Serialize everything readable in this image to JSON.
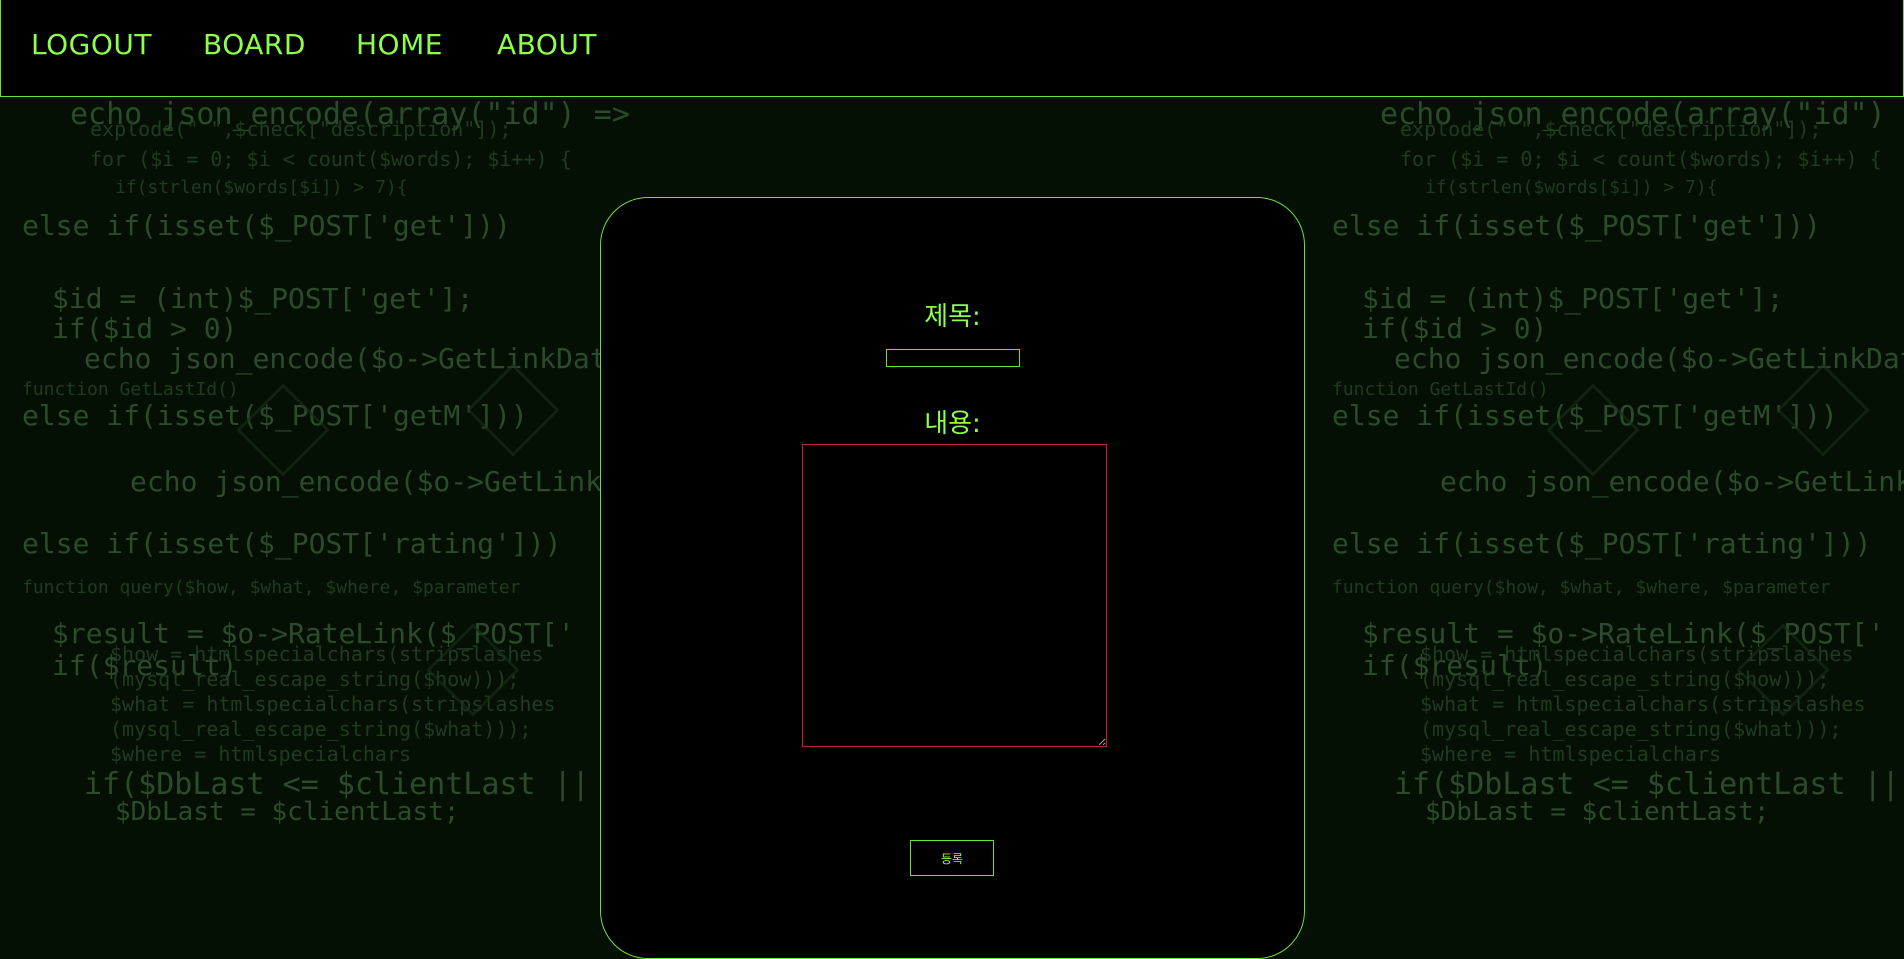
{
  "nav": {
    "items": [
      {
        "label": "LOGOUT"
      },
      {
        "label": "BOARD"
      },
      {
        "label": "HOME"
      },
      {
        "label": "ABOUT"
      }
    ]
  },
  "form": {
    "title_label": "제목:",
    "title_value": "",
    "content_label": "내용:",
    "content_value": "",
    "submit_label": "등록"
  },
  "background_code": [
    "echo json_encode(array(\"id\") => $DbLast, \"r\" => $o->GetReserved",
    "explode(\" \",$check[\"description\"]);",
    "for ($i = 0; $i < count($words); $i++) {",
    "if(strlen($words[$i]) > 7){",
    "else if(isset($_POST['get']))",
    "$id = (int)$_POST['get'];",
    "if($id > 0)",
    "echo json_encode($o->GetLinkData",
    "function GetLastId()",
    "else if(isset($_POST['getM']))",
    "echo json_encode($o->GetLinksData",
    "else if(isset($_POST['rating']))",
    "function query($how, $what, $where, $parameter",
    "$result = $o->RateLink($_POST['",
    "if($result)",
    "$how = htmlspecialchars(stripslashes",
    "(mysql_real_escape_string($how)));",
    "$what = htmlspecialchars(stripslashes",
    "(mysql_real_escape_string($what)));",
    "$where = htmlspecialchars",
    "if($DbLast <= $clientLast ||",
    "$DbLast = $clientLast;"
  ],
  "colors": {
    "accent": "#8cff4a",
    "border": "#6fe13c",
    "textarea_border": "#c81e3c",
    "background": "#031003"
  }
}
